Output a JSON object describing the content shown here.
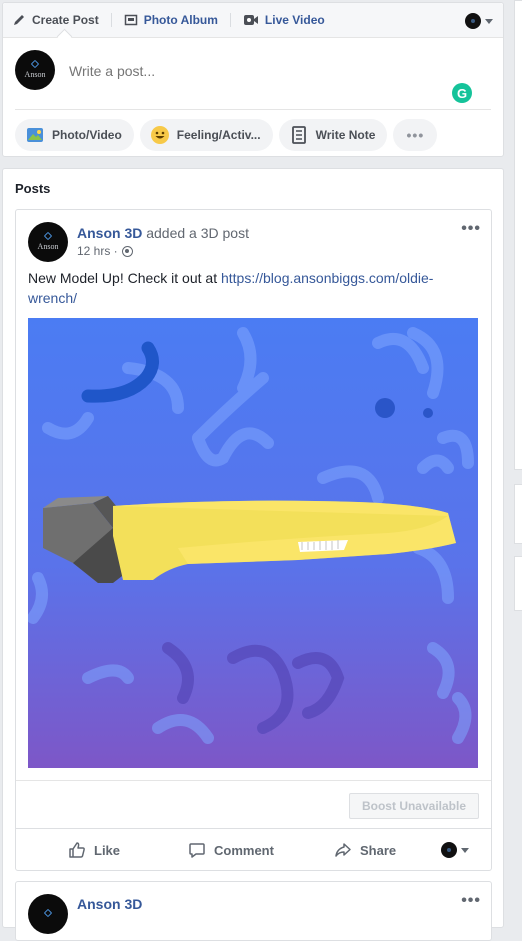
{
  "composer": {
    "tabs": [
      {
        "label": "Create Post",
        "icon": "pencil-icon"
      },
      {
        "label": "Photo Album",
        "icon": "album-icon"
      },
      {
        "label": "Live Video",
        "icon": "video-camera-icon"
      }
    ],
    "placeholder": "Write a post...",
    "avatar_text": "Anson",
    "actions": [
      {
        "label": "Photo/Video",
        "icon": "photo-icon"
      },
      {
        "label": "Feeling/Activ...",
        "icon": "smiley-icon"
      },
      {
        "label": "Write Note",
        "icon": "note-icon"
      },
      {
        "label": "•••",
        "icon": "more-icon"
      }
    ],
    "grammarly_glyph": "G"
  },
  "posts": {
    "heading": "Posts",
    "items": [
      {
        "author": "Anson 3D",
        "action": "added a 3D post",
        "time": "12 hrs ·",
        "text_prefix": "New Model Up! Check it out at ",
        "link": "https://blog.ansonbiggs.com/oldie-wrench/",
        "boost_label": "Boost Unavailable",
        "reactions": {
          "like": "Like",
          "comment": "Comment",
          "share": "Share"
        },
        "image_subject": "3D model of a wrench with a yellow handle on a blue-purple patterned background"
      },
      {
        "author": "Anson 3D"
      }
    ],
    "more_glyph": "•••"
  },
  "colors": {
    "link": "#365899",
    "page_bg": "#e9ebee",
    "grammarly": "#15c39a",
    "wrench_handle": "#f3e05a",
    "image_bg_top": "#4d79f0",
    "image_bg_bottom": "#7f5bc9"
  }
}
